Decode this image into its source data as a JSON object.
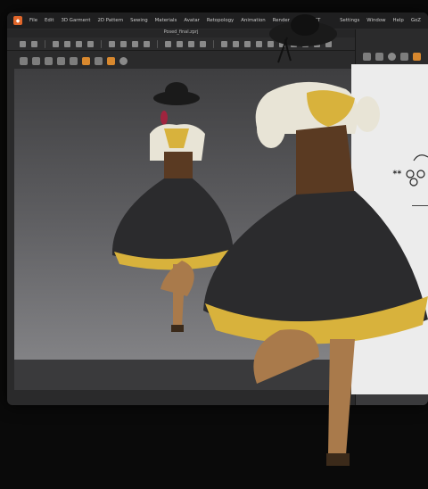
{
  "menubar": {
    "items": [
      "File",
      "Edit",
      "3D Garment",
      "2D Pattern",
      "Sewing",
      "Materials",
      "Avatar",
      "Retopology",
      "Animation",
      "Render",
      "CONNECT",
      "Settings",
      "Window",
      "Help",
      "GoZ"
    ]
  },
  "document": {
    "title": "Posed_final.zprj"
  },
  "colors": {
    "accent": "#e0662a",
    "skirt_black": "#2b2b2d",
    "petticoat_yellow": "#d8b23c",
    "corset_brown": "#5a3a22",
    "boot_tan": "#a97a4b",
    "blouse_white": "#e8e4d6"
  },
  "icons": {
    "app": "clo-app-logo-icon",
    "hat": "black-wide-brim-hat-icon"
  },
  "right_panel": {
    "icons": [
      "wand-icon",
      "cube-icon",
      "pattern-icon",
      "sewing-icon",
      "folder-icon"
    ]
  }
}
